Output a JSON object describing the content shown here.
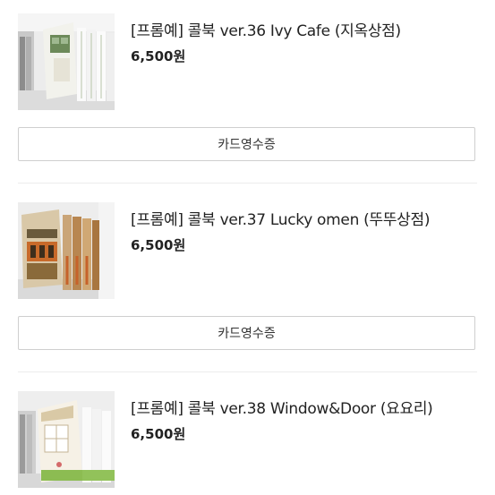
{
  "orders": [
    {
      "name": "[프롬예] 콜북 ver.36 Ivy Cafe (지옥상점)",
      "price": "6,500원",
      "receipt_label": "카드영수증",
      "thumbnail": "ivy-cafe-book-photo"
    },
    {
      "name": "[프롬예] 콜북 ver.37 Lucky omen (뚜뚜상점)",
      "price": "6,500원",
      "receipt_label": "카드영수증",
      "thumbnail": "lucky-omen-book-photo"
    },
    {
      "name": "[프롬예] 콜북 ver.38 Window&Door (요요리)",
      "price": "6,500원",
      "thumbnail": "window-door-book-photo"
    }
  ]
}
